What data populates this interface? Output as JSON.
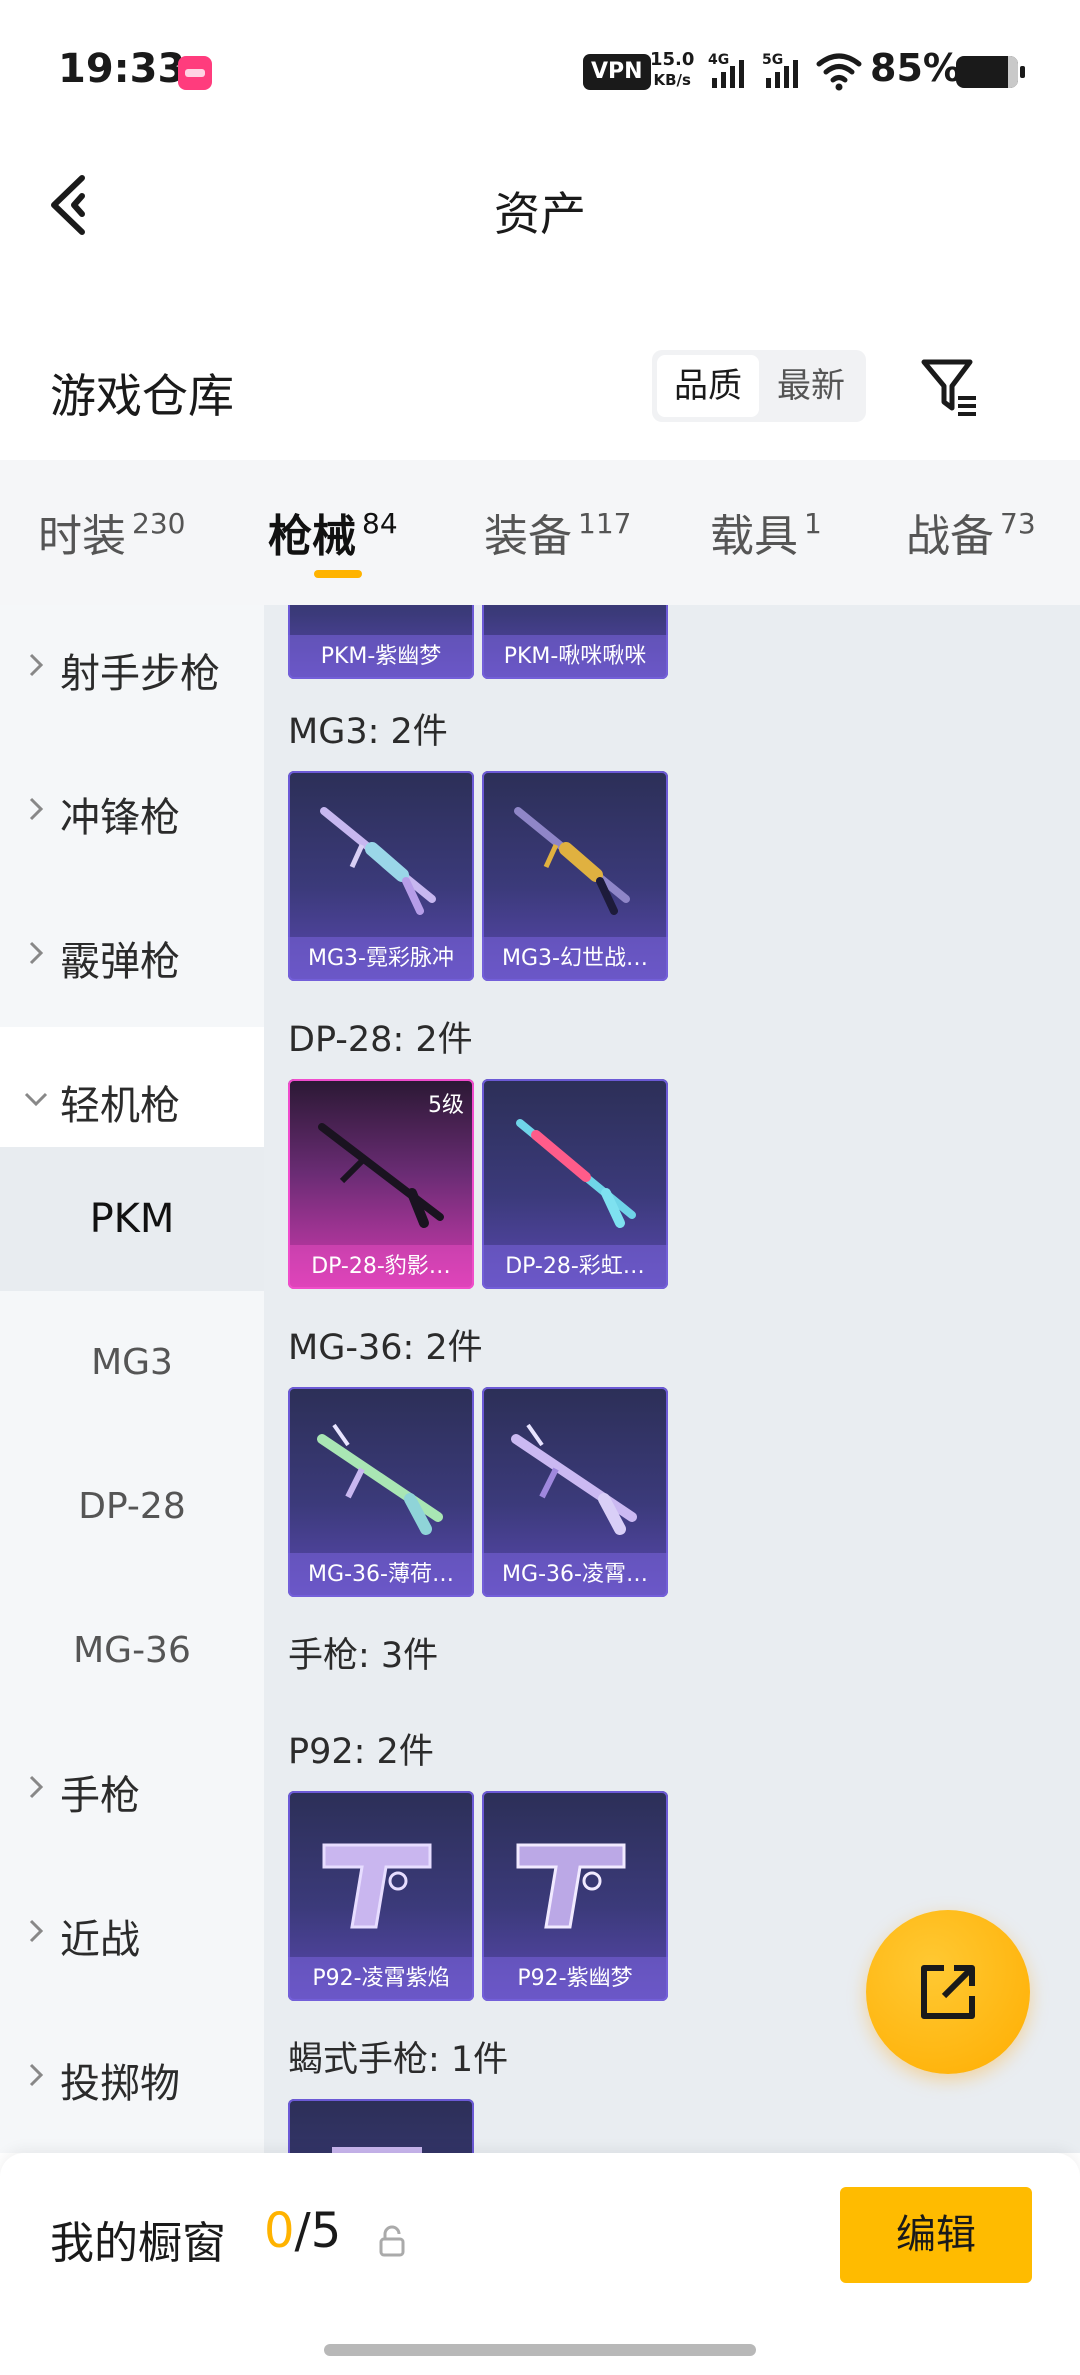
{
  "status_bar": {
    "time": "19:33",
    "vpn": "VPN",
    "net_speed_value": "15.0",
    "net_speed_unit": "KB/s",
    "sim1": "4G",
    "sim2": "5G",
    "battery": "85%"
  },
  "header": {
    "title": "资产"
  },
  "section": {
    "title": "游戏仓库",
    "sort_options": [
      "品质",
      "最新"
    ],
    "sort_active": "品质"
  },
  "tabs": [
    {
      "label": "时装",
      "count": "230"
    },
    {
      "label": "枪械",
      "count": "84",
      "active": true
    },
    {
      "label": "装备",
      "count": "117"
    },
    {
      "label": "载具",
      "count": "1"
    },
    {
      "label": "战备",
      "count": "73"
    }
  ],
  "sidebar": {
    "categories": [
      {
        "label": "射手步枪",
        "expanded": false
      },
      {
        "label": "冲锋枪",
        "expanded": false
      },
      {
        "label": "霰弹枪",
        "expanded": false
      },
      {
        "label": "轻机枪",
        "expanded": true
      },
      {
        "label": "手枪",
        "expanded": false
      },
      {
        "label": "近战",
        "expanded": false
      },
      {
        "label": "投掷物",
        "expanded": false
      }
    ],
    "subitems": [
      "PKM",
      "MG3",
      "DP-28",
      "MG-36"
    ],
    "selected_subitem": "PKM"
  },
  "content": {
    "top_cards": [
      "PKM-紫幽梦",
      "PKM-啾咪啾咪"
    ],
    "groups": [
      {
        "title": "MG3: 2件",
        "cards": [
          {
            "name": "MG3-霓彩脉冲"
          },
          {
            "name": "MG3-幻世战…"
          }
        ]
      },
      {
        "title": "DP-28: 2件",
        "cards": [
          {
            "name": "DP-28-豹影…",
            "level": "5级",
            "rarity": "pink"
          },
          {
            "name": "DP-28-彩虹…"
          }
        ]
      },
      {
        "title": "MG-36: 2件",
        "cards": [
          {
            "name": "MG-36-薄荷…"
          },
          {
            "name": "MG-36-凌霄…"
          }
        ]
      },
      {
        "title": "手枪: 3件"
      },
      {
        "title": "P92: 2件",
        "cards": [
          {
            "name": "P92-凌霄紫焰"
          },
          {
            "name": "P92-紫幽梦"
          }
        ]
      },
      {
        "title": "蝎式手枪: 1件"
      }
    ]
  },
  "fab": {
    "icon": "share-icon"
  },
  "bottom_bar": {
    "label": "我的橱窗",
    "count_current": "0",
    "count_total": "/5",
    "edit_label": "编辑"
  },
  "colors": {
    "accent": "#ffb300",
    "card_purple": "#3b3a7a",
    "card_pink": "#d33bb0"
  }
}
